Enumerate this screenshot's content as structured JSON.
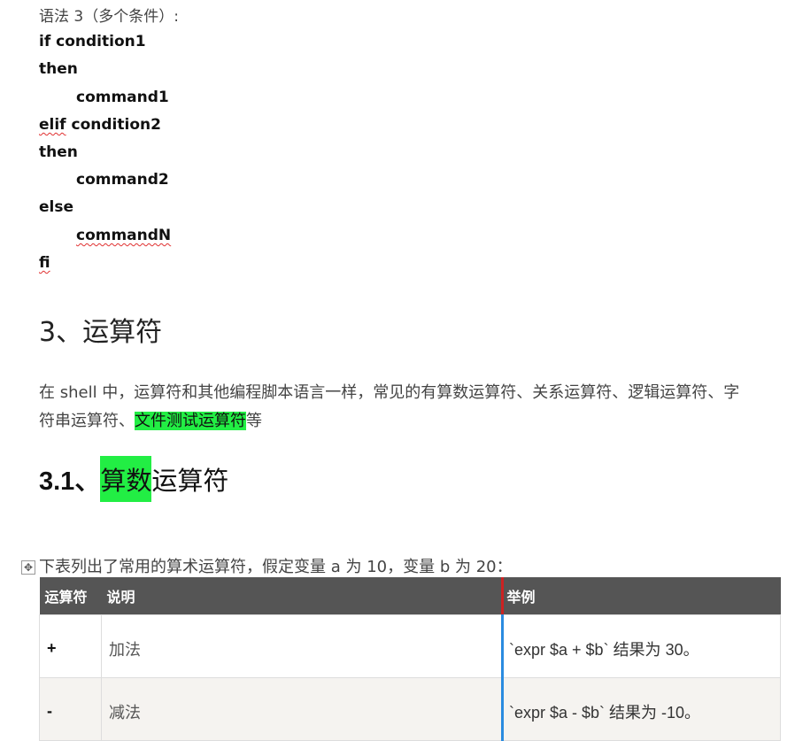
{
  "syntax": {
    "heading": "语法 3（多个条件）:",
    "lines": [
      "if condition1",
      "then",
      "command1",
      "elif condition2",
      "then",
      "command2",
      "else",
      "commandN",
      "fi"
    ],
    "elif_word": "elif",
    "elif_rest": " condition2"
  },
  "section3": {
    "title": "3、运算符"
  },
  "paragraph": {
    "text_before": "在 shell 中，运算符和其他编程脚本语言一样，常见的有算数运算符、关系运算符、逻辑运算符、字符串运算符、",
    "highlight": "文件测试运算符",
    "text_after": "等"
  },
  "section31": {
    "num": "3.1、",
    "highlight": "算数",
    "rest": "运算符"
  },
  "table_intro": "下表列出了常用的算术运算符，假定变量 a 为 10，变量 b 为 20：",
  "move_handle_glyph": "✥",
  "table": {
    "headers": [
      "运算符",
      "说明",
      "举例"
    ],
    "rows": [
      {
        "op": "+",
        "desc": "加法",
        "example": "`expr $a + $b` 结果为 30。"
      },
      {
        "op": "-",
        "desc": "减法",
        "example": "`expr $a - $b` 结果为 -10。"
      }
    ]
  },
  "colors": {
    "highlight": "#22ee44",
    "table_header_bg": "#555555",
    "col_marker_red": "#cc2222",
    "col_marker_blue": "#2a8be0"
  }
}
